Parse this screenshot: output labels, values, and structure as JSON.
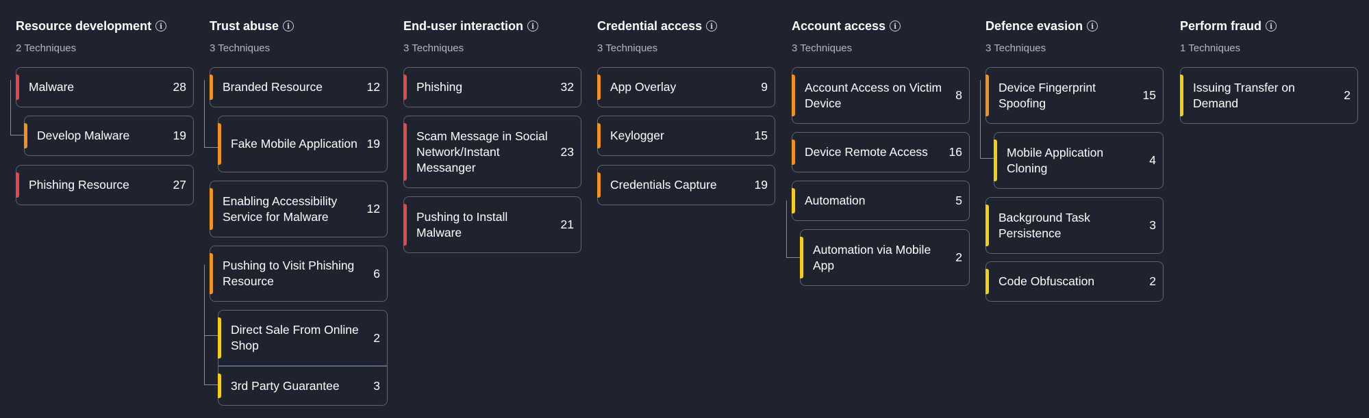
{
  "colors": {
    "background": "#1f2330",
    "card_border": "#5f6574",
    "red": "#e04a4a",
    "orange": "#f0921e",
    "yellow": "#f5cc16"
  },
  "columns": [
    {
      "title": "Resource development",
      "subtitle": "2 Techniques",
      "cards": [
        {
          "name": "Malware",
          "count": "28",
          "severity": "red"
        },
        {
          "name": "Develop Malware",
          "count": "19",
          "severity": "orange"
        },
        {
          "name": "Phishing Resource",
          "count": "27",
          "severity": "red"
        }
      ]
    },
    {
      "title": "Trust abuse",
      "subtitle": "3 Techniques",
      "cards": [
        {
          "name": "Branded Resource",
          "count": "12",
          "severity": "orange"
        },
        {
          "name": "Fake Mobile Application",
          "count": "19",
          "severity": "orange"
        },
        {
          "name": "Enabling Accessibility Service for Malware",
          "count": "12",
          "severity": "orange"
        },
        {
          "name": "Pushing to Visit Phishing Resource",
          "count": "6",
          "severity": "orange"
        },
        {
          "name": "Direct Sale From Online Shop",
          "count": "2",
          "severity": "yellow"
        },
        {
          "name": "3rd Party Guarantee",
          "count": "3",
          "severity": "yellow"
        }
      ]
    },
    {
      "title": "End-user interaction",
      "subtitle": "3 Techniques",
      "cards": [
        {
          "name": "Phishing",
          "count": "32",
          "severity": "red"
        },
        {
          "name": "Scam Message in Social Network/Instant Messanger",
          "count": "23",
          "severity": "red"
        },
        {
          "name": "Pushing to Install Malware",
          "count": "21",
          "severity": "red"
        }
      ]
    },
    {
      "title": "Credential access",
      "subtitle": "3 Techniques",
      "cards": [
        {
          "name": "App Overlay",
          "count": "9",
          "severity": "orange"
        },
        {
          "name": "Keylogger",
          "count": "15",
          "severity": "orange"
        },
        {
          "name": "Credentials Capture",
          "count": "19",
          "severity": "orange"
        }
      ]
    },
    {
      "title": "Account access",
      "subtitle": "3 Techniques",
      "cards": [
        {
          "name": "Account Access on Victim Device",
          "count": "8",
          "severity": "orange"
        },
        {
          "name": "Device Remote Access",
          "count": "16",
          "severity": "orange"
        },
        {
          "name": "Automation",
          "count": "5",
          "severity": "yellow"
        },
        {
          "name": "Automation via Mobile App",
          "count": "2",
          "severity": "yellow"
        }
      ]
    },
    {
      "title": "Defence evasion",
      "subtitle": "3 Techniques",
      "cards": [
        {
          "name": "Device Fingerprint Spoofing",
          "count": "15",
          "severity": "orange"
        },
        {
          "name": "Mobile Application Cloning",
          "count": "4",
          "severity": "yellow"
        },
        {
          "name": "Background Task Persistence",
          "count": "3",
          "severity": "yellow"
        },
        {
          "name": "Code Obfuscation",
          "count": "2",
          "severity": "yellow"
        }
      ]
    },
    {
      "title": "Perform fraud",
      "subtitle": "1 Techniques",
      "cards": [
        {
          "name": "Issuing Transfer on Demand",
          "count": "2",
          "severity": "yellow"
        }
      ]
    }
  ]
}
